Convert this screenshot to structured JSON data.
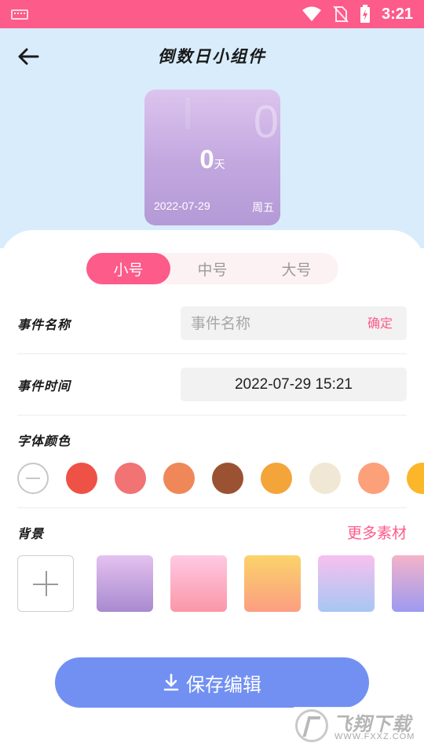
{
  "status_bar": {
    "time": "3:21",
    "icons": [
      "keyboard-icon",
      "wifi-icon",
      "no-sim-icon",
      "battery-charging-icon"
    ]
  },
  "header": {
    "title": "倒数日小组件",
    "back_icon": "arrow-left-icon"
  },
  "preview": {
    "count": "0",
    "unit": "天",
    "background_digit": "0",
    "date": "2022-07-29",
    "weekday": "周五"
  },
  "size_tabs": [
    {
      "label": "小号",
      "active": true
    },
    {
      "label": "中号",
      "active": false
    },
    {
      "label": "大号",
      "active": false
    }
  ],
  "event_name": {
    "label": "事件名称",
    "placeholder": "事件名称",
    "value": "",
    "confirm_label": "确定"
  },
  "event_time": {
    "label": "事件时间",
    "value": "2022-07-29 15:21"
  },
  "font_color": {
    "label": "字体颜色",
    "options": [
      "none",
      "#ee5145",
      "#f17373",
      "#ef8759",
      "#9a5232",
      "#f3a53a",
      "#f0e8d4",
      "#fca07a",
      "#fbb62a"
    ]
  },
  "background": {
    "label": "背景",
    "more_label": "更多素材",
    "add_icon": "plus-icon",
    "options": [
      {
        "colors": [
          "#e4c1ef",
          "#a88acf"
        ]
      },
      {
        "colors": [
          "#ffc9e3",
          "#fa97a7"
        ]
      },
      {
        "colors": [
          "#fbd36a",
          "#fb9e82"
        ]
      },
      {
        "colors": [
          "#f7c0ee",
          "#a7c6f3"
        ]
      },
      {
        "colors": [
          "#f4b3c9",
          "#9d9af0"
        ]
      }
    ]
  },
  "save_button": {
    "label": "保存编辑",
    "icon": "download-icon"
  },
  "watermark": {
    "title": "飞翔下载",
    "url": "WWW.FXXZ.COM"
  },
  "colors": {
    "status_bar": "#fd5b8a",
    "accent": "#fd5b8a",
    "header_bg": "#d9ecfb",
    "save_button": "#7190f2"
  }
}
